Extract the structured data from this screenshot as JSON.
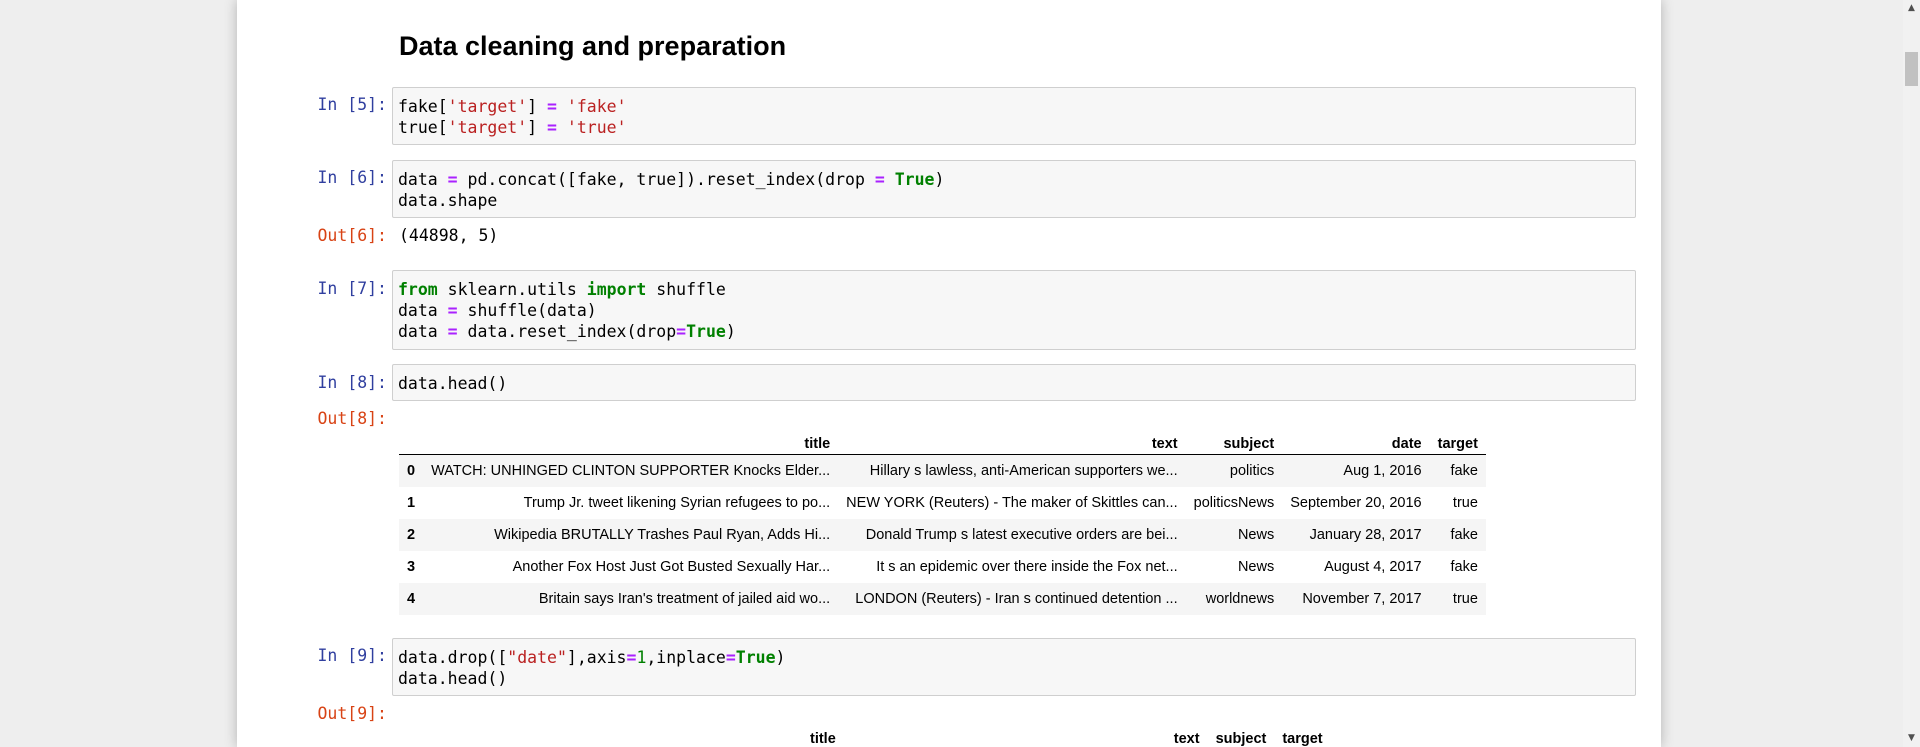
{
  "heading": "Data cleaning and preparation",
  "cells": {
    "c5": {
      "prompt": "In [5]:",
      "lines": [
        [
          [
            "n",
            "fake["
          ],
          [
            "s",
            "'target'"
          ],
          [
            "n",
            "] "
          ],
          [
            "o",
            "="
          ],
          [
            "n",
            " "
          ],
          [
            "s",
            "'fake'"
          ]
        ],
        [
          [
            "n",
            "true["
          ],
          [
            "s",
            "'target'"
          ],
          [
            "n",
            "] "
          ],
          [
            "o",
            "="
          ],
          [
            "n",
            " "
          ],
          [
            "s",
            "'true'"
          ]
        ]
      ]
    },
    "c6": {
      "prompt": "In [6]:",
      "out_prompt": "Out[6]:",
      "output": "(44898, 5)",
      "lines": [
        [
          [
            "n",
            "data "
          ],
          [
            "o",
            "="
          ],
          [
            "n",
            " pd.concat([fake, true]).reset_index(drop "
          ],
          [
            "o",
            "="
          ],
          [
            "n",
            " "
          ],
          [
            "k",
            "True"
          ],
          [
            "n",
            ")"
          ]
        ],
        [
          [
            "n",
            "data.shape"
          ]
        ]
      ]
    },
    "c7": {
      "prompt": "In [7]:",
      "lines": [
        [
          [
            "k",
            "from"
          ],
          [
            "n",
            " sklearn.utils "
          ],
          [
            "k",
            "import"
          ],
          [
            "n",
            " shuffle"
          ]
        ],
        [
          [
            "n",
            "data "
          ],
          [
            "o",
            "="
          ],
          [
            "n",
            " shuffle(data)"
          ]
        ],
        [
          [
            "n",
            "data "
          ],
          [
            "o",
            "="
          ],
          [
            "n",
            " data.reset_index(drop"
          ],
          [
            "o",
            "="
          ],
          [
            "k",
            "True"
          ],
          [
            "n",
            ")"
          ]
        ]
      ]
    },
    "c8": {
      "prompt": "In [8]:",
      "out_prompt": "Out[8]:",
      "lines": [
        [
          [
            "n",
            "data.head()"
          ]
        ]
      ],
      "table": {
        "columns": [
          "",
          "title",
          "text",
          "subject",
          "date",
          "target"
        ],
        "rows": [
          [
            "0",
            "WATCH: UNHINGED CLINTON SUPPORTER Knocks Elder...",
            "Hillary s lawless, anti-American supporters we...",
            "politics",
            "Aug 1, 2016",
            "fake"
          ],
          [
            "1",
            "Trump Jr. tweet likening Syrian refugees to po...",
            "NEW YORK (Reuters) - The maker of Skittles can...",
            "politicsNews",
            "September 20, 2016",
            "true"
          ],
          [
            "2",
            "Wikipedia BRUTALLY Trashes Paul Ryan, Adds Hi...",
            "Donald Trump s latest executive orders are bei...",
            "News",
            "January 28, 2017",
            "fake"
          ],
          [
            "3",
            "Another Fox Host Just Got Busted Sexually Har...",
            "It s an epidemic over there inside the Fox net...",
            "News",
            "August 4, 2017",
            "fake"
          ],
          [
            "4",
            "Britain says Iran's treatment of jailed aid wo...",
            "LONDON (Reuters) - Iran s continued detention ...",
            "worldnews",
            "November 7, 2017",
            "true"
          ]
        ]
      }
    },
    "c9": {
      "prompt": "In [9]:",
      "out_prompt": "Out[9]:",
      "lines": [
        [
          [
            "n",
            "data.drop(["
          ],
          [
            "s",
            "\"date\""
          ],
          [
            "n",
            "],axis"
          ],
          [
            "o",
            "="
          ],
          [
            "m",
            "1"
          ],
          [
            "n",
            ",inplace"
          ],
          [
            "o",
            "="
          ],
          [
            "k",
            "True"
          ],
          [
            "n",
            ")"
          ]
        ],
        [
          [
            "n",
            "data.head()"
          ]
        ]
      ],
      "table_columns": [
        "title",
        "text",
        "subject",
        "target"
      ]
    }
  },
  "scrollbar": {
    "up_arrow": "▲",
    "down_arrow": "▼"
  }
}
